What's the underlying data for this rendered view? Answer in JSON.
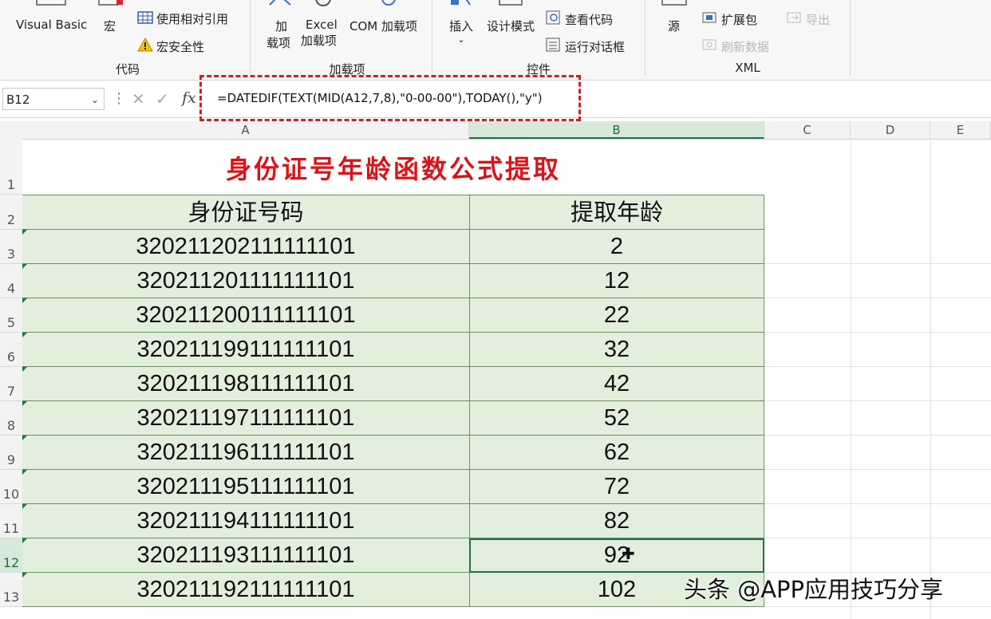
{
  "ribbon": {
    "code_group": {
      "label": "代码",
      "visual_basic": "Visual Basic",
      "macro": "宏",
      "relative_ref": "使用相对引用",
      "macro_security": "宏安全性"
    },
    "addins_group": {
      "label": "加载项",
      "addins_line1": "加",
      "addins_line2": "载项",
      "excel_addins_line1": "Excel",
      "excel_addins_line2": "加载项",
      "com_addins": "COM 加载项"
    },
    "controls_group": {
      "label": "控件",
      "insert": "插入",
      "design_mode": "设计模式",
      "view_code": "查看代码",
      "run_dialog": "运行对话框"
    },
    "xml_group": {
      "label": "XML",
      "source": "源",
      "expansion_packs": "扩展包",
      "refresh_data": "刷新数据",
      "export": "导出"
    }
  },
  "formula_bar": {
    "name_box": "B12",
    "fx": "fx",
    "formula": "=DATEDIF(TEXT(MID(A12,7,8),\"0-00-00\"),TODAY(),\"y\")"
  },
  "sheet": {
    "columns": [
      "A",
      "B",
      "C",
      "D",
      "E"
    ],
    "title": "身份证号年龄函数公式提取",
    "headers": [
      "身份证号码",
      "提取年龄"
    ],
    "rows": [
      {
        "row": "3",
        "id": "320211202111111101",
        "age": "2"
      },
      {
        "row": "4",
        "id": "320211201111111101",
        "age": "12"
      },
      {
        "row": "5",
        "id": "320211200111111101",
        "age": "22"
      },
      {
        "row": "6",
        "id": "320211199111111101",
        "age": "32"
      },
      {
        "row": "7",
        "id": "320211198111111101",
        "age": "42"
      },
      {
        "row": "8",
        "id": "320211197111111101",
        "age": "52"
      },
      {
        "row": "9",
        "id": "320211196111111101",
        "age": "62"
      },
      {
        "row": "10",
        "id": "320211195111111101",
        "age": "72"
      },
      {
        "row": "11",
        "id": "320211194111111101",
        "age": "82"
      },
      {
        "row": "12",
        "id": "320211193111111101",
        "age": "92"
      },
      {
        "row": "13",
        "id": "320211192111111101",
        "age": "102"
      }
    ],
    "row_header_1": "1",
    "row_header_2": "2"
  },
  "watermark": "头条 @APP应用技巧分享",
  "colors": {
    "title_red": "#d8141a",
    "cell_fill": "#e2efdc",
    "excel_green": "#217346"
  }
}
